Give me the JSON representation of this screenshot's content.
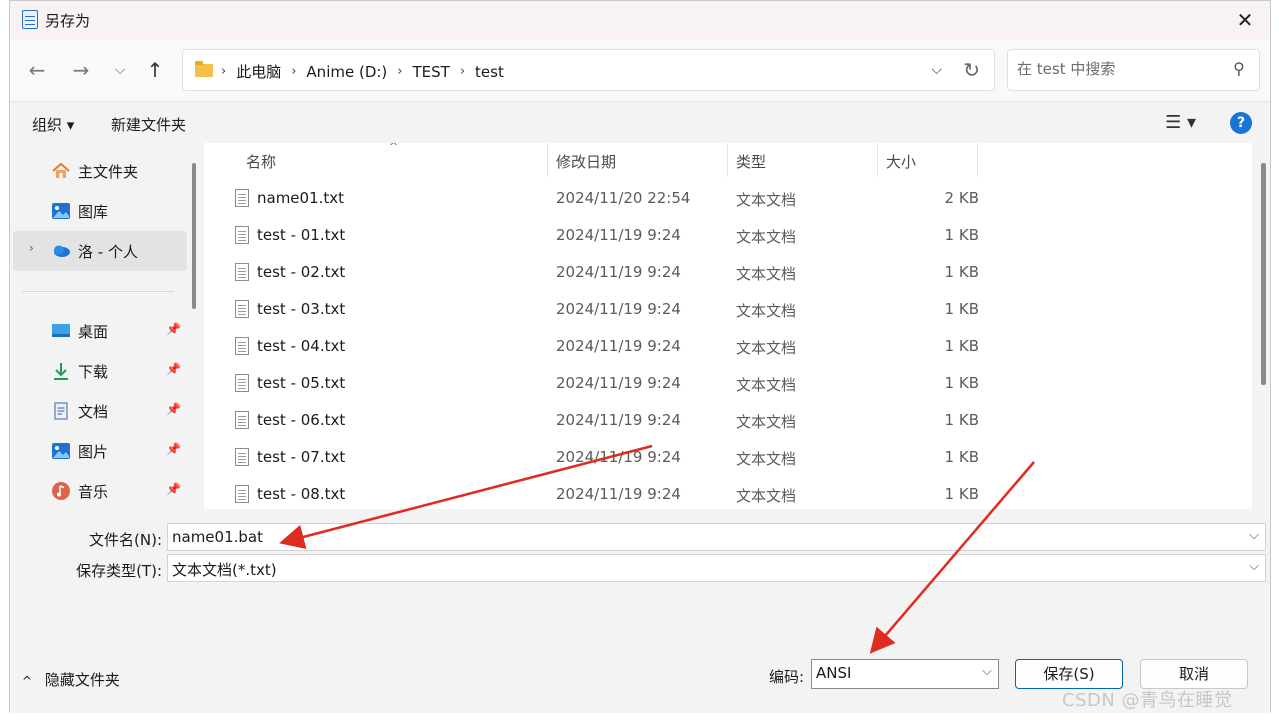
{
  "window": {
    "title": "另存为",
    "close_glyph": "✕"
  },
  "nav": {
    "back": "←",
    "forward": "→",
    "recent": "⌵",
    "up": "↑"
  },
  "address": {
    "crumbs": [
      "此电脑",
      "Anime (D:)",
      "TEST",
      "test"
    ],
    "separator": "›",
    "dropdown": "⌵",
    "refresh": "↻"
  },
  "search": {
    "placeholder": "在 test 中搜索",
    "icon": "⚲"
  },
  "toolbar": {
    "organize": "组织 ▾",
    "new_folder": "新建文件夹",
    "view": "☰ ▾",
    "help": "?"
  },
  "sidebar": {
    "items": [
      {
        "label": "主文件夹",
        "icon": "home-icon"
      },
      {
        "label": "图库",
        "icon": "gallery-icon"
      },
      {
        "label": "洛 - 个人",
        "icon": "onedrive-icon",
        "chevron": "›"
      },
      {
        "label": "桌面",
        "icon": "desktop-icon",
        "pin": "📌"
      },
      {
        "label": "下载",
        "icon": "download-icon",
        "pin": "📌"
      },
      {
        "label": "文档",
        "icon": "document-icon",
        "pin": "📌"
      },
      {
        "label": "图片",
        "icon": "pictures-icon",
        "pin": "📌"
      },
      {
        "label": "音乐",
        "icon": "music-icon",
        "pin": "📌"
      }
    ]
  },
  "list": {
    "columns": {
      "name": "名称",
      "modified": "修改日期",
      "type": "类型",
      "size": "大小"
    },
    "sort_glyph": "^",
    "rows": [
      {
        "name": "name01.txt",
        "modified": "2024/11/20 22:54",
        "type": "文本文档",
        "size": "2 KB"
      },
      {
        "name": "test - 01.txt",
        "modified": "2024/11/19 9:24",
        "type": "文本文档",
        "size": "1 KB"
      },
      {
        "name": "test - 02.txt",
        "modified": "2024/11/19 9:24",
        "type": "文本文档",
        "size": "1 KB"
      },
      {
        "name": "test - 03.txt",
        "modified": "2024/11/19 9:24",
        "type": "文本文档",
        "size": "1 KB"
      },
      {
        "name": "test - 04.txt",
        "modified": "2024/11/19 9:24",
        "type": "文本文档",
        "size": "1 KB"
      },
      {
        "name": "test - 05.txt",
        "modified": "2024/11/19 9:24",
        "type": "文本文档",
        "size": "1 KB"
      },
      {
        "name": "test - 06.txt",
        "modified": "2024/11/19 9:24",
        "type": "文本文档",
        "size": "1 KB"
      },
      {
        "name": "test - 07.txt",
        "modified": "2024/11/19 9:24",
        "type": "文本文档",
        "size": "1 KB"
      },
      {
        "name": "test - 08.txt",
        "modified": "2024/11/19 9:24",
        "type": "文本文档",
        "size": "1 KB"
      }
    ]
  },
  "form": {
    "filename_label": "文件名(N):",
    "filename_value": "name01.bat",
    "filetype_label": "保存类型(T):",
    "filetype_value": "文本文档(*.txt)",
    "encoding_label": "编码:",
    "encoding_value": "ANSI",
    "dropdown": "⌵",
    "save_label": "保存(S)",
    "cancel_label": "取消",
    "hide_folders_label": "隐藏文件夹",
    "hide_caret": "^"
  },
  "watermark": "CSDN @青鸟在睡觉",
  "colors": {
    "accent": "#0067c0",
    "annotation_arrow": "#e02b20",
    "help_icon": "#1a73d6",
    "folder": "#f3c14b"
  }
}
